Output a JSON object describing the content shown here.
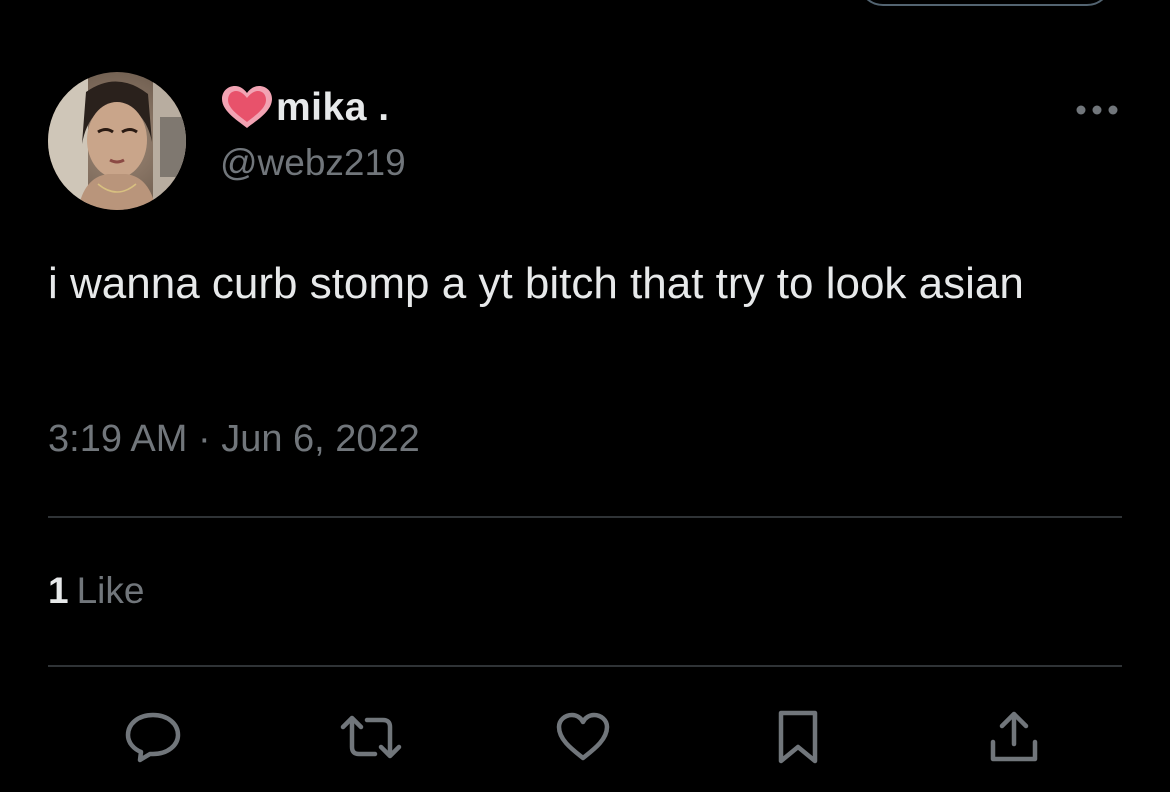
{
  "tweet": {
    "author": {
      "display_name": "mika .",
      "handle": "@webz219",
      "avatar_icon": "profile-photo",
      "name_emoji": "heart-emoji"
    },
    "text": "i wanna curb stomp a yt bitch that try to look asian",
    "timestamp": "3:19 AM · Jun 6, 2022",
    "likes": {
      "count": "1",
      "label": "Like"
    },
    "actions": [
      {
        "name": "reply",
        "icon": "reply-icon"
      },
      {
        "name": "retweet",
        "icon": "retweet-icon"
      },
      {
        "name": "like",
        "icon": "heart-icon"
      },
      {
        "name": "bookmark",
        "icon": "bookmark-icon"
      },
      {
        "name": "share",
        "icon": "share-icon"
      }
    ]
  },
  "colors": {
    "background": "#000000",
    "primary_text": "#e7e9ea",
    "secondary_text": "#71767b",
    "divider": "#2f3336",
    "emoji_heart": "#e8526b"
  }
}
